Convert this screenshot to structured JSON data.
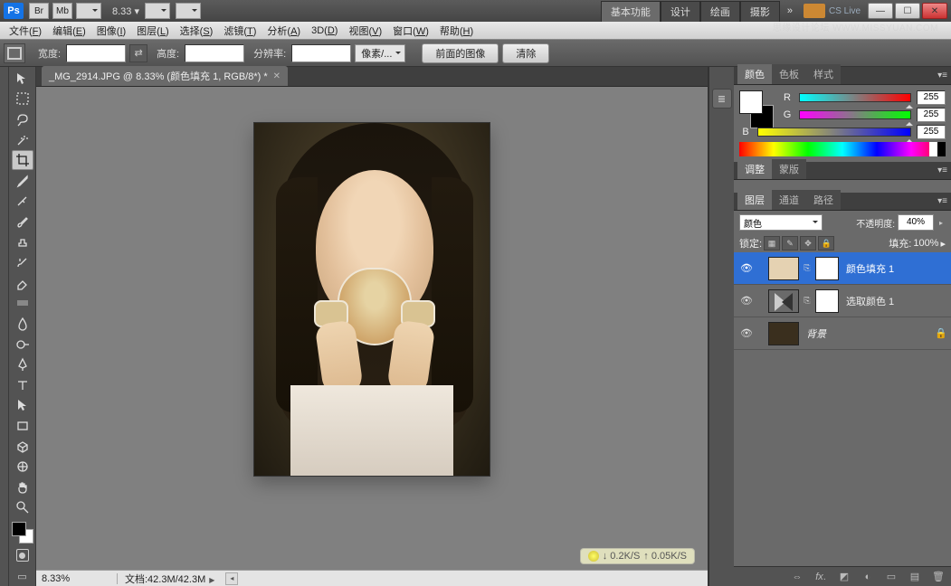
{
  "app_bar": {
    "br": "Br",
    "mb": "Mb",
    "zoom": "8.33 ▾",
    "workspace_tabs": [
      "基本功能",
      "设计",
      "绘画",
      "摄影"
    ],
    "more": "»",
    "cs_live": "CS Live"
  },
  "menu": {
    "items": [
      {
        "label": "文件",
        "mn": "F"
      },
      {
        "label": "编辑",
        "mn": "E"
      },
      {
        "label": "图像",
        "mn": "I"
      },
      {
        "label": "图层",
        "mn": "L"
      },
      {
        "label": "选择",
        "mn": "S"
      },
      {
        "label": "滤镜",
        "mn": "T"
      },
      {
        "label": "分析",
        "mn": "A"
      },
      {
        "label": "3D",
        "mn": "D"
      },
      {
        "label": "视图",
        "mn": "V"
      },
      {
        "label": "窗口",
        "mn": "W"
      },
      {
        "label": "帮助",
        "mn": "H"
      }
    ]
  },
  "options": {
    "width": "宽度:",
    "height": "高度:",
    "res": "分辨率:",
    "unit": "像素/...",
    "front_image": "前面的图像",
    "clear": "清除"
  },
  "document": {
    "tab_title": "_MG_2914.JPG @ 8.33% (颜色填充 1, RGB/8*) *"
  },
  "net_status": {
    "down": "↓  0.2K/S",
    "up": "↑  0.05K/S"
  },
  "status_bar": {
    "zoom": "8.33%",
    "doc": "文档:42.3M/42.3M"
  },
  "color_panel": {
    "tabs": [
      "颜色",
      "色板",
      "样式"
    ],
    "r_label": "R",
    "r_value": "255",
    "g_label": "G",
    "g_value": "255",
    "b_label": "B",
    "b_value": "255"
  },
  "adjust_panel": {
    "tabs": [
      "调整",
      "蒙版"
    ]
  },
  "layers_panel": {
    "tabs": [
      "图层",
      "通道",
      "路径"
    ],
    "blend_mode": "颜色",
    "opacity_label": "不透明度:",
    "opacity_value": "40%",
    "lock_label": "锁定:",
    "fill_label": "填充:",
    "fill_value": "100%",
    "layers": [
      {
        "name": "颜色填充 1"
      },
      {
        "name": "选取颜色 1"
      },
      {
        "name": "背景"
      }
    ]
  },
  "watermark": "思缘设计论坛  WWW.MISSYUAN.COM"
}
